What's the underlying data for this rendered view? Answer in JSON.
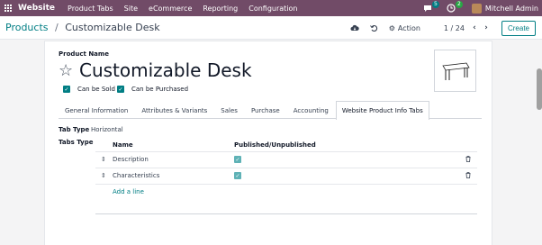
{
  "topnav": {
    "brand": "Website",
    "menu": [
      "Product Tabs",
      "Site",
      "eCommerce",
      "Reporting",
      "Configuration"
    ],
    "chat_count": "5",
    "activity_count": "2",
    "user_name": "Mitchell Admin",
    "bg_color": "#714B67"
  },
  "control": {
    "breadcrumb_parent": "Products",
    "breadcrumb_separator": "/",
    "breadcrumb_current": "Customizable Desk",
    "action_label": "Action",
    "pager": "1 / 24",
    "prev": "‹",
    "next": "›",
    "create_label": "Create"
  },
  "form": {
    "product_name_label": "Product Name",
    "product_name": "Customizable Desk",
    "can_be_sold": "Can be Sold",
    "can_be_purchased": "Can be Purchased",
    "tabs": [
      "General Information",
      "Attributes & Variants",
      "Sales",
      "Purchase",
      "Accounting",
      "Website Product Info Tabs"
    ],
    "active_tab": "Website Product Info Tabs",
    "tab_type_label": "Tab Type",
    "tab_type_value": "Horizontal",
    "tabs_type_label": "Tabs Type",
    "table": {
      "col_name": "Name",
      "col_published": "Published/Unpublished",
      "rows": [
        {
          "name": "Description",
          "published": true
        },
        {
          "name": "Characteristics",
          "published": true
        }
      ],
      "add_line": "Add a line"
    }
  },
  "colors": {
    "accent": "#017e84",
    "checkbox": "#017e84",
    "brand": "#714B67"
  }
}
